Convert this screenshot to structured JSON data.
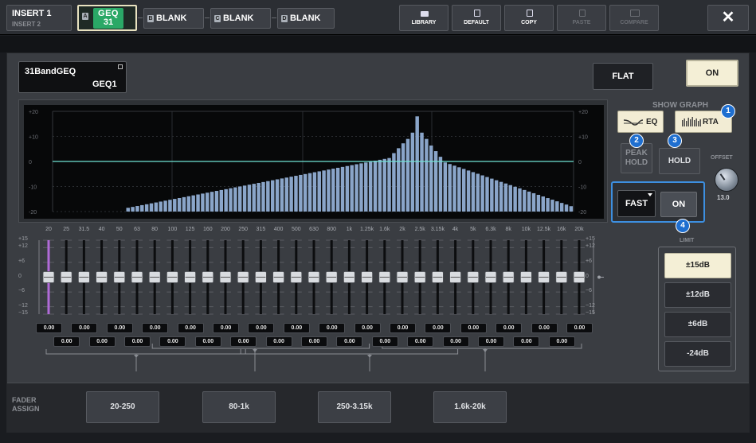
{
  "topbar": {
    "insert_label": "INSERT 1",
    "insert_sub": "INSERT 2",
    "slots": [
      {
        "num": "A",
        "label": ""
      },
      {
        "num": "B",
        "label": "BLANK"
      },
      {
        "num": "C",
        "label": "BLANK"
      },
      {
        "num": "D",
        "label": "BLANK"
      }
    ],
    "geq_badge_top": "GEQ",
    "geq_badge_bottom": "31",
    "tools": [
      {
        "label": "LIBRARY",
        "icon": "folder-icon",
        "enabled": true
      },
      {
        "label": "DEFAULT",
        "icon": "document-icon",
        "enabled": true
      },
      {
        "label": "COPY",
        "icon": "copy-icon",
        "enabled": true
      },
      {
        "label": "PASTE",
        "icon": "paste-icon",
        "enabled": false
      },
      {
        "label": "COMPARE",
        "icon": "compare-icon",
        "enabled": false
      }
    ],
    "close_label": "✕"
  },
  "rack": {
    "name_line1": "31BandGEQ",
    "name_line2": "GEQ1",
    "flat_label": "FLAT",
    "on_label": "ON"
  },
  "graph": {
    "y_labels": [
      "+20",
      "+10",
      "0",
      "-10",
      "-20"
    ]
  },
  "show_graph": {
    "title": "SHOW GRAPH",
    "eq_label": "EQ",
    "rta_label": "RTA",
    "peak_line1": "PEAK",
    "peak_line2": "HOLD",
    "hold_label": "HOLD",
    "offset_label": "OFFSET",
    "offset_value": "13.0",
    "speed_label": "FAST",
    "rta_on_label": "ON"
  },
  "badges": [
    "1",
    "2",
    "3",
    "4"
  ],
  "faders": {
    "frequencies": [
      "20",
      "25",
      "31.5",
      "40",
      "50",
      "63",
      "80",
      "100",
      "125",
      "160",
      "200",
      "250",
      "315",
      "400",
      "500",
      "630",
      "800",
      "1k",
      "1.25k",
      "1.6k",
      "2k",
      "2.5k",
      "3.15k",
      "4k",
      "5k",
      "6.3k",
      "8k",
      "10k",
      "12.5k",
      "16k",
      "20k"
    ],
    "scale_labels": [
      "+15",
      "+12",
      "+6",
      "0",
      "−6",
      "−12",
      "−15"
    ],
    "gains": [
      "0.00",
      "0.00",
      "0.00",
      "0.00",
      "0.00",
      "0.00",
      "0.00",
      "0.00",
      "0.00",
      "0.00",
      "0.00",
      "0.00",
      "0.00",
      "0.00",
      "0.00",
      "0.00",
      "0.00",
      "0.00",
      "0.00",
      "0.00",
      "0.00",
      "0.00",
      "0.00",
      "0.00",
      "0.00",
      "0.00",
      "0.00",
      "0.00",
      "0.00",
      "0.00",
      "0.00"
    ]
  },
  "limit": {
    "label": "LIMIT",
    "options": [
      "±15dB",
      "±12dB",
      "±6dB",
      "-24dB"
    ],
    "selected": 0
  },
  "fader_assign": {
    "label_line1": "FADER",
    "label_line2": "ASSIGN",
    "ranges": [
      "20-250",
      "80-1k",
      "250-3.15k",
      "1.6k-20k"
    ]
  },
  "colors": {
    "accent_green": "#2aa866",
    "selected_cream": "#f4efd6",
    "highlight_blue": "#3d8fe0",
    "badge_blue": "#1f6fd0",
    "fader_range_purple": "#b06ad8"
  }
}
